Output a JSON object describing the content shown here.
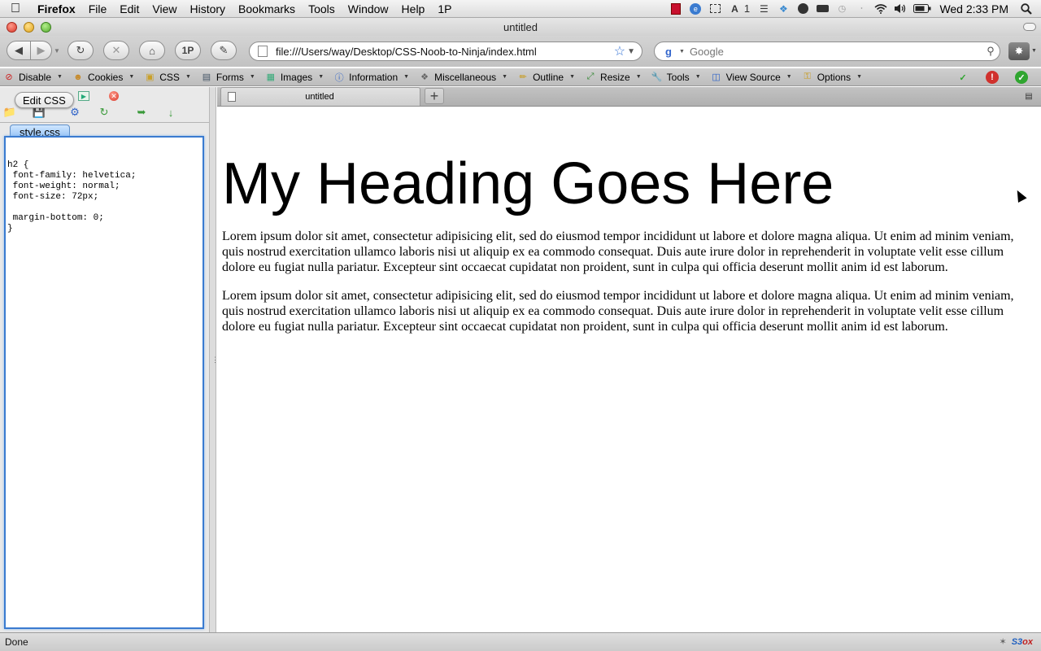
{
  "menubar": {
    "app_name": "Firefox",
    "items": [
      "File",
      "Edit",
      "View",
      "History",
      "Bookmarks",
      "Tools",
      "Window",
      "Help",
      "1P"
    ],
    "clock": "Wed 2:33 PM",
    "tray_badge": "1"
  },
  "window": {
    "title": "untitled"
  },
  "navbar": {
    "onepassword_label": "1P",
    "url": "file:///Users/way/Desktop/CSS-Noob-to-Ninja/index.html",
    "search_placeholder": "Google"
  },
  "webdev_toolbar": {
    "items": [
      "Disable",
      "Cookies",
      "CSS",
      "Forms",
      "Images",
      "Information",
      "Miscellaneous",
      "Outline",
      "Resize",
      "Tools",
      "View Source",
      "Options"
    ]
  },
  "sidebar": {
    "tooltip": "Edit CSS",
    "file_tab": "style.css",
    "css_text": "h2 {\n font-family: helvetica;\n font-weight: normal;\n font-size: 72px;\n\n margin-bottom: 0;\n}"
  },
  "tabs": {
    "active_title": "untitled",
    "new_tab_label": "+"
  },
  "page": {
    "heading": "My Heading Goes Here",
    "paragraphs": [
      "Lorem ipsum dolor sit amet, consectetur adipisicing elit, sed do eiusmod tempor incididunt ut labore et dolore magna aliqua. Ut enim ad minim veniam, quis nostrud exercitation ullamco laboris nisi ut aliquip ex ea commodo consequat. Duis aute irure dolor in reprehenderit in voluptate velit esse cillum dolore eu fugiat nulla pariatur. Excepteur sint occaecat cupidatat non proident, sunt in culpa qui officia deserunt mollit anim id est laborum.",
      "Lorem ipsum dolor sit amet, consectetur adipisicing elit, sed do eiusmod tempor incididunt ut labore et dolore magna aliqua. Ut enim ad minim veniam, quis nostrud exercitation ullamco laboris nisi ut aliquip ex ea commodo consequat. Duis aute irure dolor in reprehenderit in voluptate velit esse cillum dolore eu fugiat nulla pariatur. Excepteur sint occaecat cupidatat non proident, sunt in culpa qui officia deserunt mollit anim id est laborum."
    ]
  },
  "statusbar": {
    "text": "Done",
    "s3fox_label": "S3",
    "s3fox_suffix": "ox"
  },
  "colors": {
    "editor_border": "#3a7bd0",
    "file_tab": "#8fbff5",
    "status_ok": "#2fa52f",
    "status_error": "#d0312d"
  }
}
